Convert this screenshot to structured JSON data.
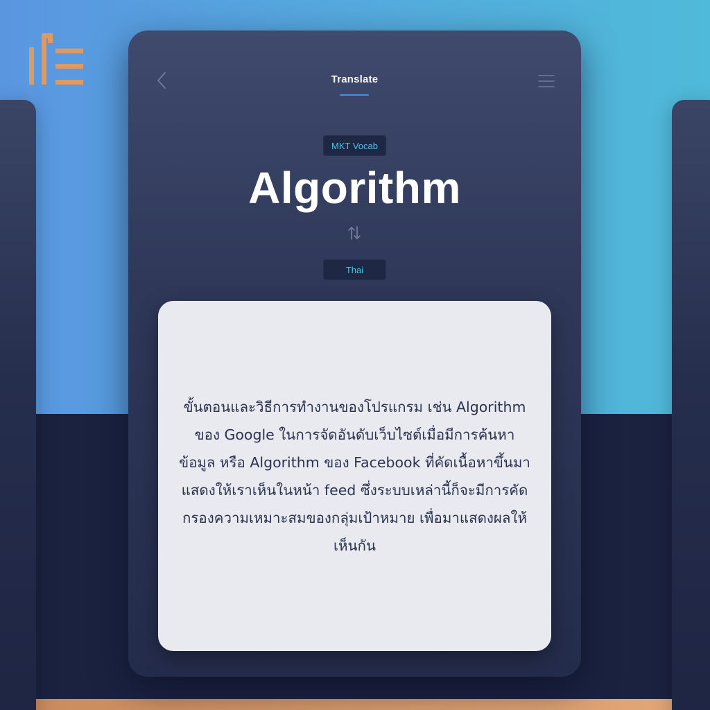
{
  "header": {
    "title": "Translate",
    "back_icon": "chevron-left-icon",
    "menu_icon": "hamburger-menu-icon"
  },
  "card": {
    "category": "MKT Vocab",
    "term": "Algorithm",
    "swap_icon": "swap-vertical-icon",
    "target_language": "Thai",
    "definition": "ขั้นตอนและวิธีการทำงานของโปรแกรม เช่น Algorithm ของ Google ในการจัดอันดับเว็บไซต์เมื่อมีการค้นหาข้อมูล หรือ Algorithm ของ Facebook ที่คัดเนื้อหาขึ้นมาแสดงให้เราเห็นในหน้า feed ซึ่งระบบเหล่านี้ก็จะมีการคัดกรองความเหมาะสมของกลุ่มเป้าหมาย เพื่อมาแสดงผลให้เห็นกัน"
  },
  "branding": {
    "logo_icon": "brand-logo-icon"
  },
  "colors": {
    "accent": "#4a90d8",
    "chip_text": "#4fc0e8",
    "brand_orange": "#e0995f",
    "card_background": "#e8eaef",
    "phone_background": "#2f3859"
  }
}
